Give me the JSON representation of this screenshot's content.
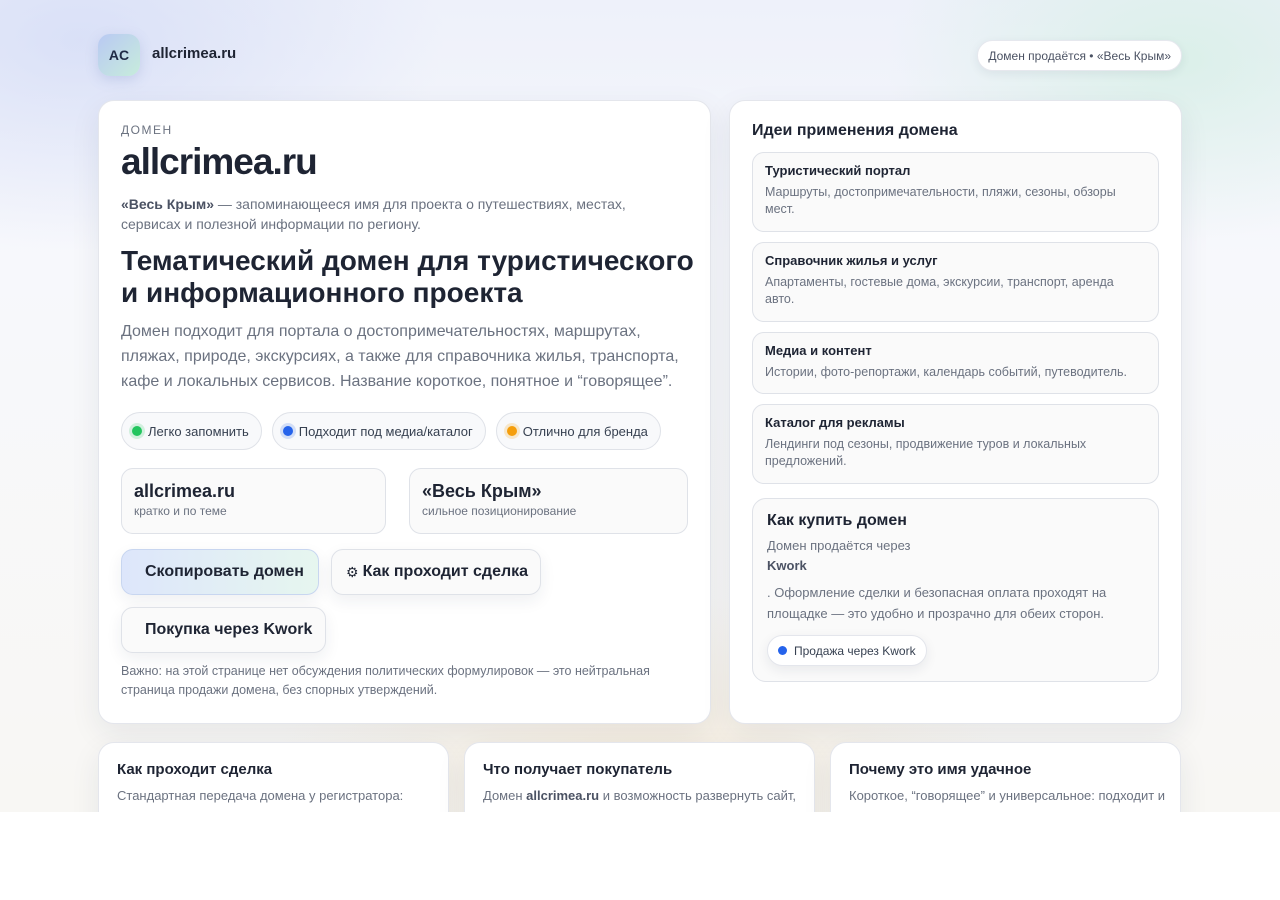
{
  "header": {
    "logo_initials": "AC",
    "site_name": "allcrimea.ru",
    "sale_badge": "Домен продаётся • «Весь Крым»"
  },
  "hero": {
    "eyebrow": "ДОМЕН",
    "domain": "allcrimea.ru",
    "intro_strong": "«Весь Крым»",
    "intro_rest": " — запоминающееся имя для проекта о путешествиях, местах, сервисах и полезной информации по региону.",
    "headline": "Тематический домен для туристического и информационного проекта",
    "lead": "Домен подходит для портала о достопримечательностях, маршрутах, пляжах, природе, экскурсиях, а также для справочника жилья, транспорта, кафе и локальных сервисов. Название короткое, понятное и “говорящее”.",
    "tags": [
      {
        "label": "Легко запомнить",
        "color": "#22c55e"
      },
      {
        "label": "Подходит под медиа/каталог",
        "color": "#2563eb"
      },
      {
        "label": "Отлично для бренда",
        "color": "#f59e0b"
      }
    ],
    "stats": [
      {
        "big": "allcrimea.ru",
        "small": "кратко и по теме"
      },
      {
        "big": "«Весь Крым»",
        "small": "сильное позиционирование"
      }
    ],
    "buttons": {
      "copy": "Скопировать домен",
      "deal_icon": "⚙",
      "deal": "Как проходит сделка",
      "kwork": "Покупка через Kwork"
    },
    "note": "Важно: на этой странице нет обсуждения политических формулировок — это нейтральная страница продажи домена, без спорных утверждений."
  },
  "ideas": {
    "title": "Идеи применения домена",
    "items": [
      {
        "title": "Туристический портал",
        "desc": "Маршруты, достопримечательности, пляжи, сезоны, обзоры мест."
      },
      {
        "title": "Справочник жилья и услуг",
        "desc": "Апартаменты, гостевые дома, экскурсии, транспорт, аренда авто."
      },
      {
        "title": "Медиа и контент",
        "desc": "Истории, фото-репортажи, календарь событий, путеводитель."
      },
      {
        "title": "Каталог для рекламы",
        "desc": "Лендинги под сезоны, продвижение туров и локальных предложений."
      }
    ]
  },
  "buy": {
    "title": "Как купить домен",
    "text_before": "Домен продаётся через",
    "link": "Kwork",
    "text_after": ". Оформление сделки и безопасная оплата проходят на площадке — это удобно и прозрачно для обеих сторон.",
    "pill": "Продажа через Kwork",
    "pill_color": "#2563eb"
  },
  "bottom": [
    {
      "title": "Как проходит сделка",
      "text": "Стандартная передача домена у регистратора: трансфер или внутрирегистраторский «пуш»."
    },
    {
      "title": "Что получает покупатель",
      "text_before": "Домен ",
      "text_strong": "allcrimea.ru",
      "text_after": " и возможность развернуть сайт, подключить почту, редиректы, аналитику и рекламу."
    },
    {
      "title": "Почему это имя удачное",
      "text": "Короткое, “говорящее” и универсальное: подходит и под путеводитель, и под каталог, и под медиа."
    }
  ]
}
